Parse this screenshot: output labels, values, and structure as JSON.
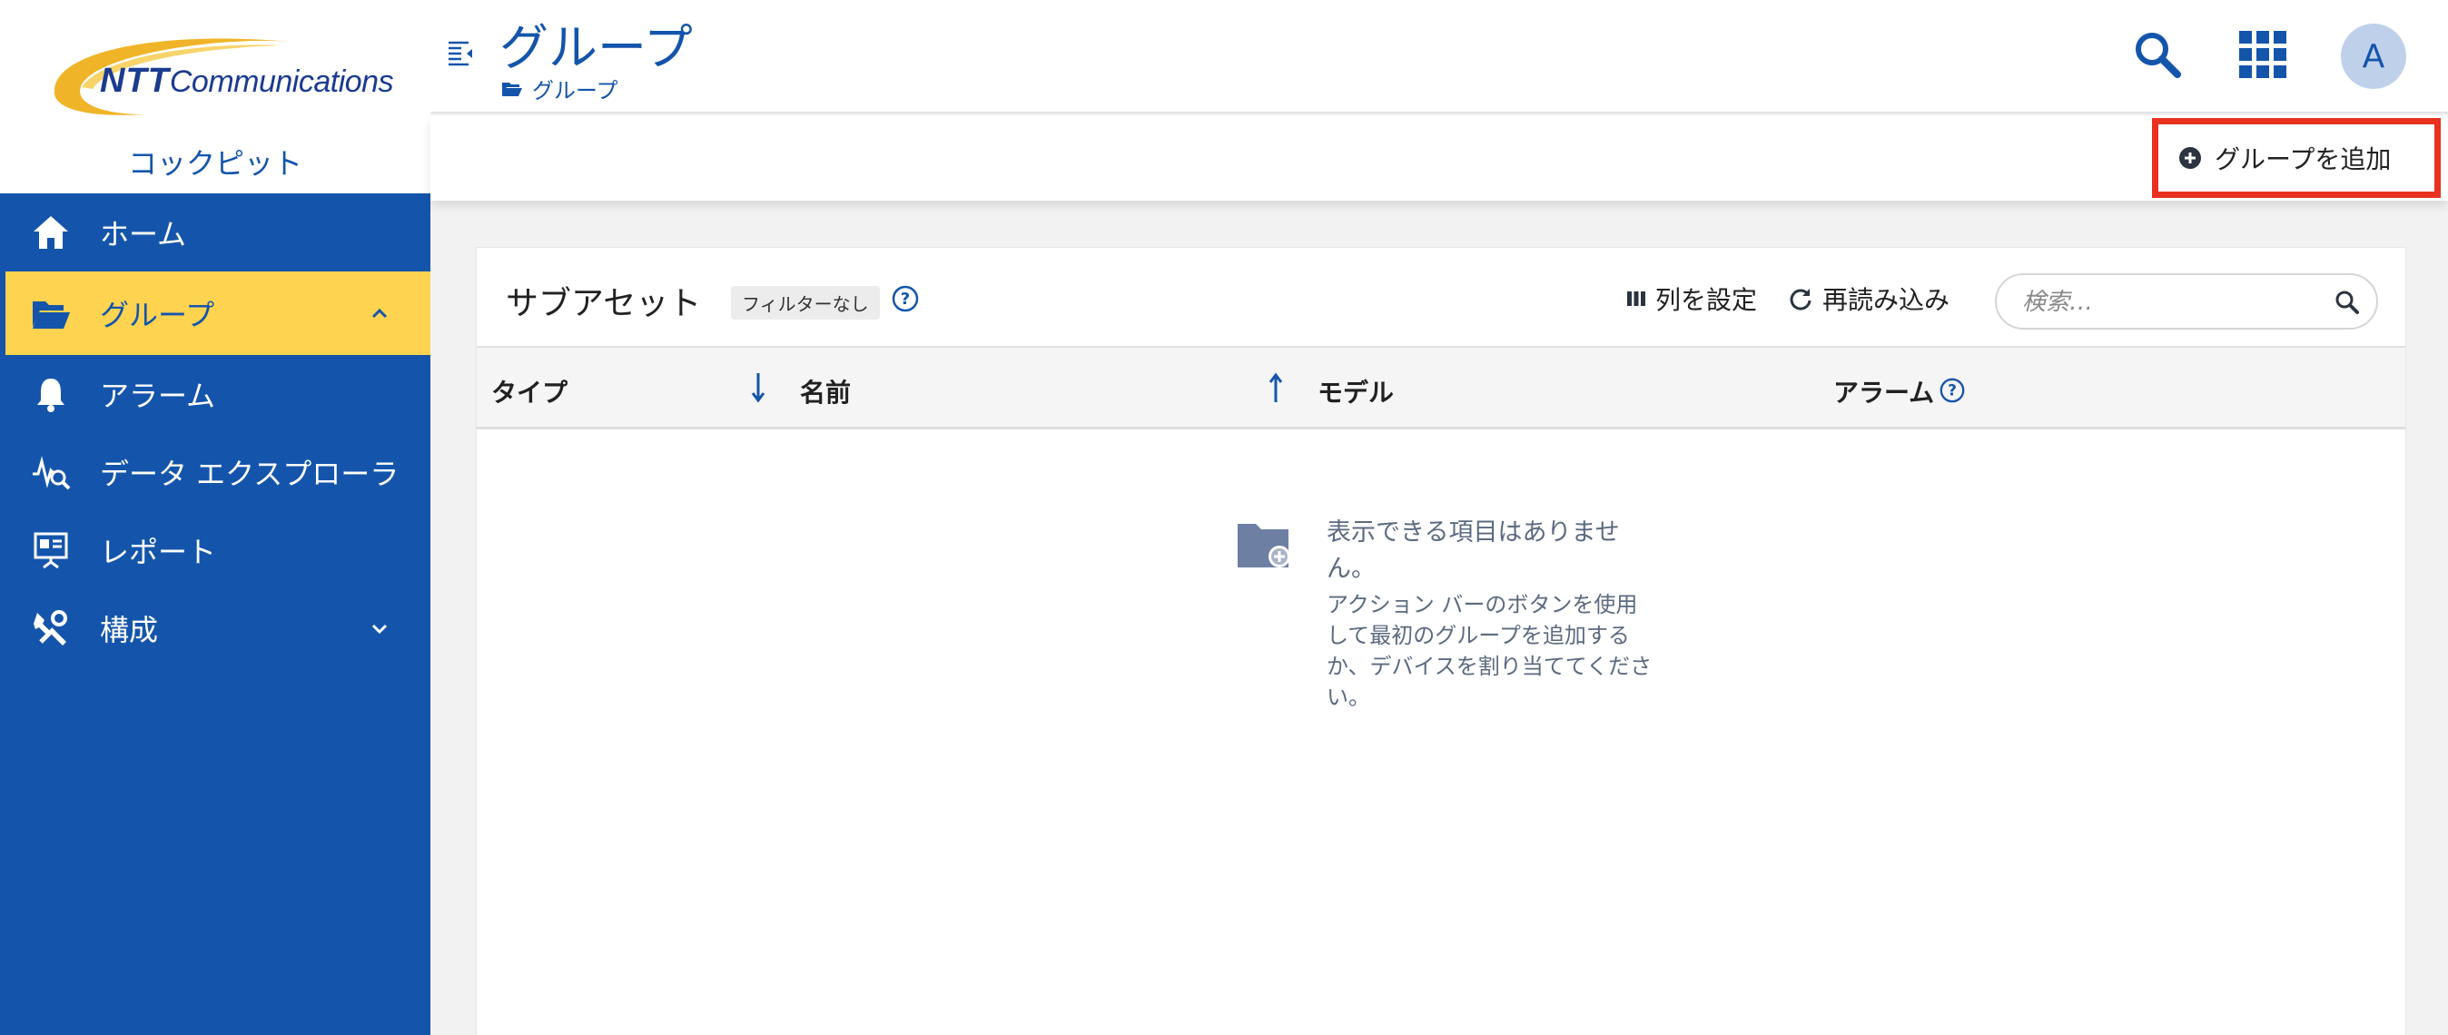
{
  "brand": {
    "logo_text_bold": "NTT",
    "logo_text": "Communications",
    "app_name": "コックピット"
  },
  "nav": {
    "items": [
      {
        "label": "ホーム",
        "icon": "home-icon"
      },
      {
        "label": "グループ",
        "icon": "folder-open-icon",
        "active": true,
        "expanded": true
      },
      {
        "label": "アラーム",
        "icon": "bell-icon"
      },
      {
        "label": "データ エクスプローラ",
        "icon": "data-explorer-icon"
      },
      {
        "label": "レポート",
        "icon": "report-icon"
      },
      {
        "label": "構成",
        "icon": "tools-icon",
        "expanded": false
      }
    ]
  },
  "header": {
    "title": "グループ",
    "breadcrumb": "グループ",
    "avatar_initial": "A"
  },
  "actions": {
    "add_group": "グループを追加"
  },
  "card": {
    "title": "サブアセット",
    "filter_badge": "フィルターなし",
    "column_settings": "列を設定",
    "reload": "再読み込み",
    "search_placeholder": "検索…",
    "columns": [
      "タイプ",
      "名前",
      "モデル",
      "アラーム"
    ],
    "empty_title": "表示できる項目はありません。",
    "empty_desc": "アクション バーのボタンを使用して最初のグループを追加するか、デバイスを割り当ててください。"
  },
  "colors": {
    "primary": "#1455ab",
    "active_nav": "#fdd34f",
    "highlight": "#e8311e"
  }
}
